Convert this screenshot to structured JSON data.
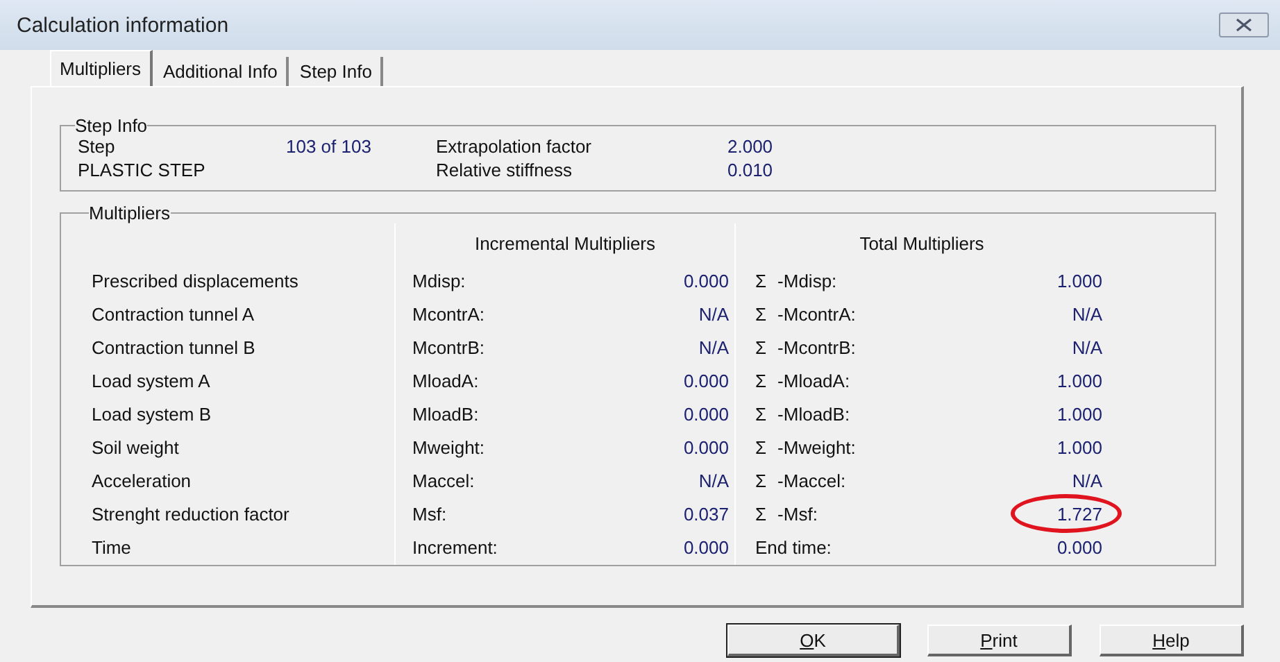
{
  "window": {
    "title": "Calculation information"
  },
  "tabs": [
    {
      "label": "Multipliers",
      "selected": true
    },
    {
      "label": "Additional Info",
      "selected": false
    },
    {
      "label": "Step Info",
      "selected": false
    }
  ],
  "step_info": {
    "title": "Step Info",
    "step_label": "Step",
    "step_value": "103 of 103",
    "phase": "PLASTIC STEP",
    "factors": [
      {
        "label": "Extrapolation factor",
        "value": "2.000"
      },
      {
        "label": "Relative stiffness",
        "value": "0.010"
      }
    ]
  },
  "multipliers": {
    "title": "Multipliers",
    "incremental_heading": "Incremental Multipliers",
    "total_heading": "Total Multipliers",
    "rows": [
      {
        "name": "Prescribed displacements",
        "inc_label": "Mdisp:",
        "inc_value": "0.000",
        "sigma": "Σ",
        "total_label": "-Mdisp:",
        "total_value": "1.000",
        "circled": false
      },
      {
        "name": "Contraction tunnel A",
        "inc_label": "McontrA:",
        "inc_value": "N/A",
        "sigma": "Σ",
        "total_label": "-McontrA:",
        "total_value": "N/A",
        "circled": false
      },
      {
        "name": "Contraction tunnel B",
        "inc_label": "McontrB:",
        "inc_value": "N/A",
        "sigma": "Σ",
        "total_label": "-McontrB:",
        "total_value": "N/A",
        "circled": false
      },
      {
        "name": "Load system A",
        "inc_label": "MloadA:",
        "inc_value": "0.000",
        "sigma": "Σ",
        "total_label": "-MloadA:",
        "total_value": "1.000",
        "circled": false
      },
      {
        "name": "Load system B",
        "inc_label": "MloadB:",
        "inc_value": "0.000",
        "sigma": "Σ",
        "total_label": "-MloadB:",
        "total_value": "1.000",
        "circled": false
      },
      {
        "name": "Soil weight",
        "inc_label": "Mweight:",
        "inc_value": "0.000",
        "sigma": "Σ",
        "total_label": "-Mweight:",
        "total_value": "1.000",
        "circled": false
      },
      {
        "name": "Acceleration",
        "inc_label": "Maccel:",
        "inc_value": "N/A",
        "sigma": "Σ",
        "total_label": "-Maccel:",
        "total_value": "N/A",
        "circled": false
      },
      {
        "name": "Strenght reduction factor",
        "inc_label": "Msf:",
        "inc_value": "0.037",
        "sigma": "Σ",
        "total_label": "-Msf:",
        "total_value": "1.727",
        "circled": true
      },
      {
        "name": "Time",
        "inc_label": "Increment:",
        "inc_value": "0.000",
        "total_label": "End time:",
        "total_value": "0.000",
        "circled": false
      }
    ]
  },
  "buttons": [
    {
      "label": "OK",
      "default": true
    },
    {
      "label": "Print",
      "default": false
    },
    {
      "label": "Help",
      "default": false
    }
  ]
}
